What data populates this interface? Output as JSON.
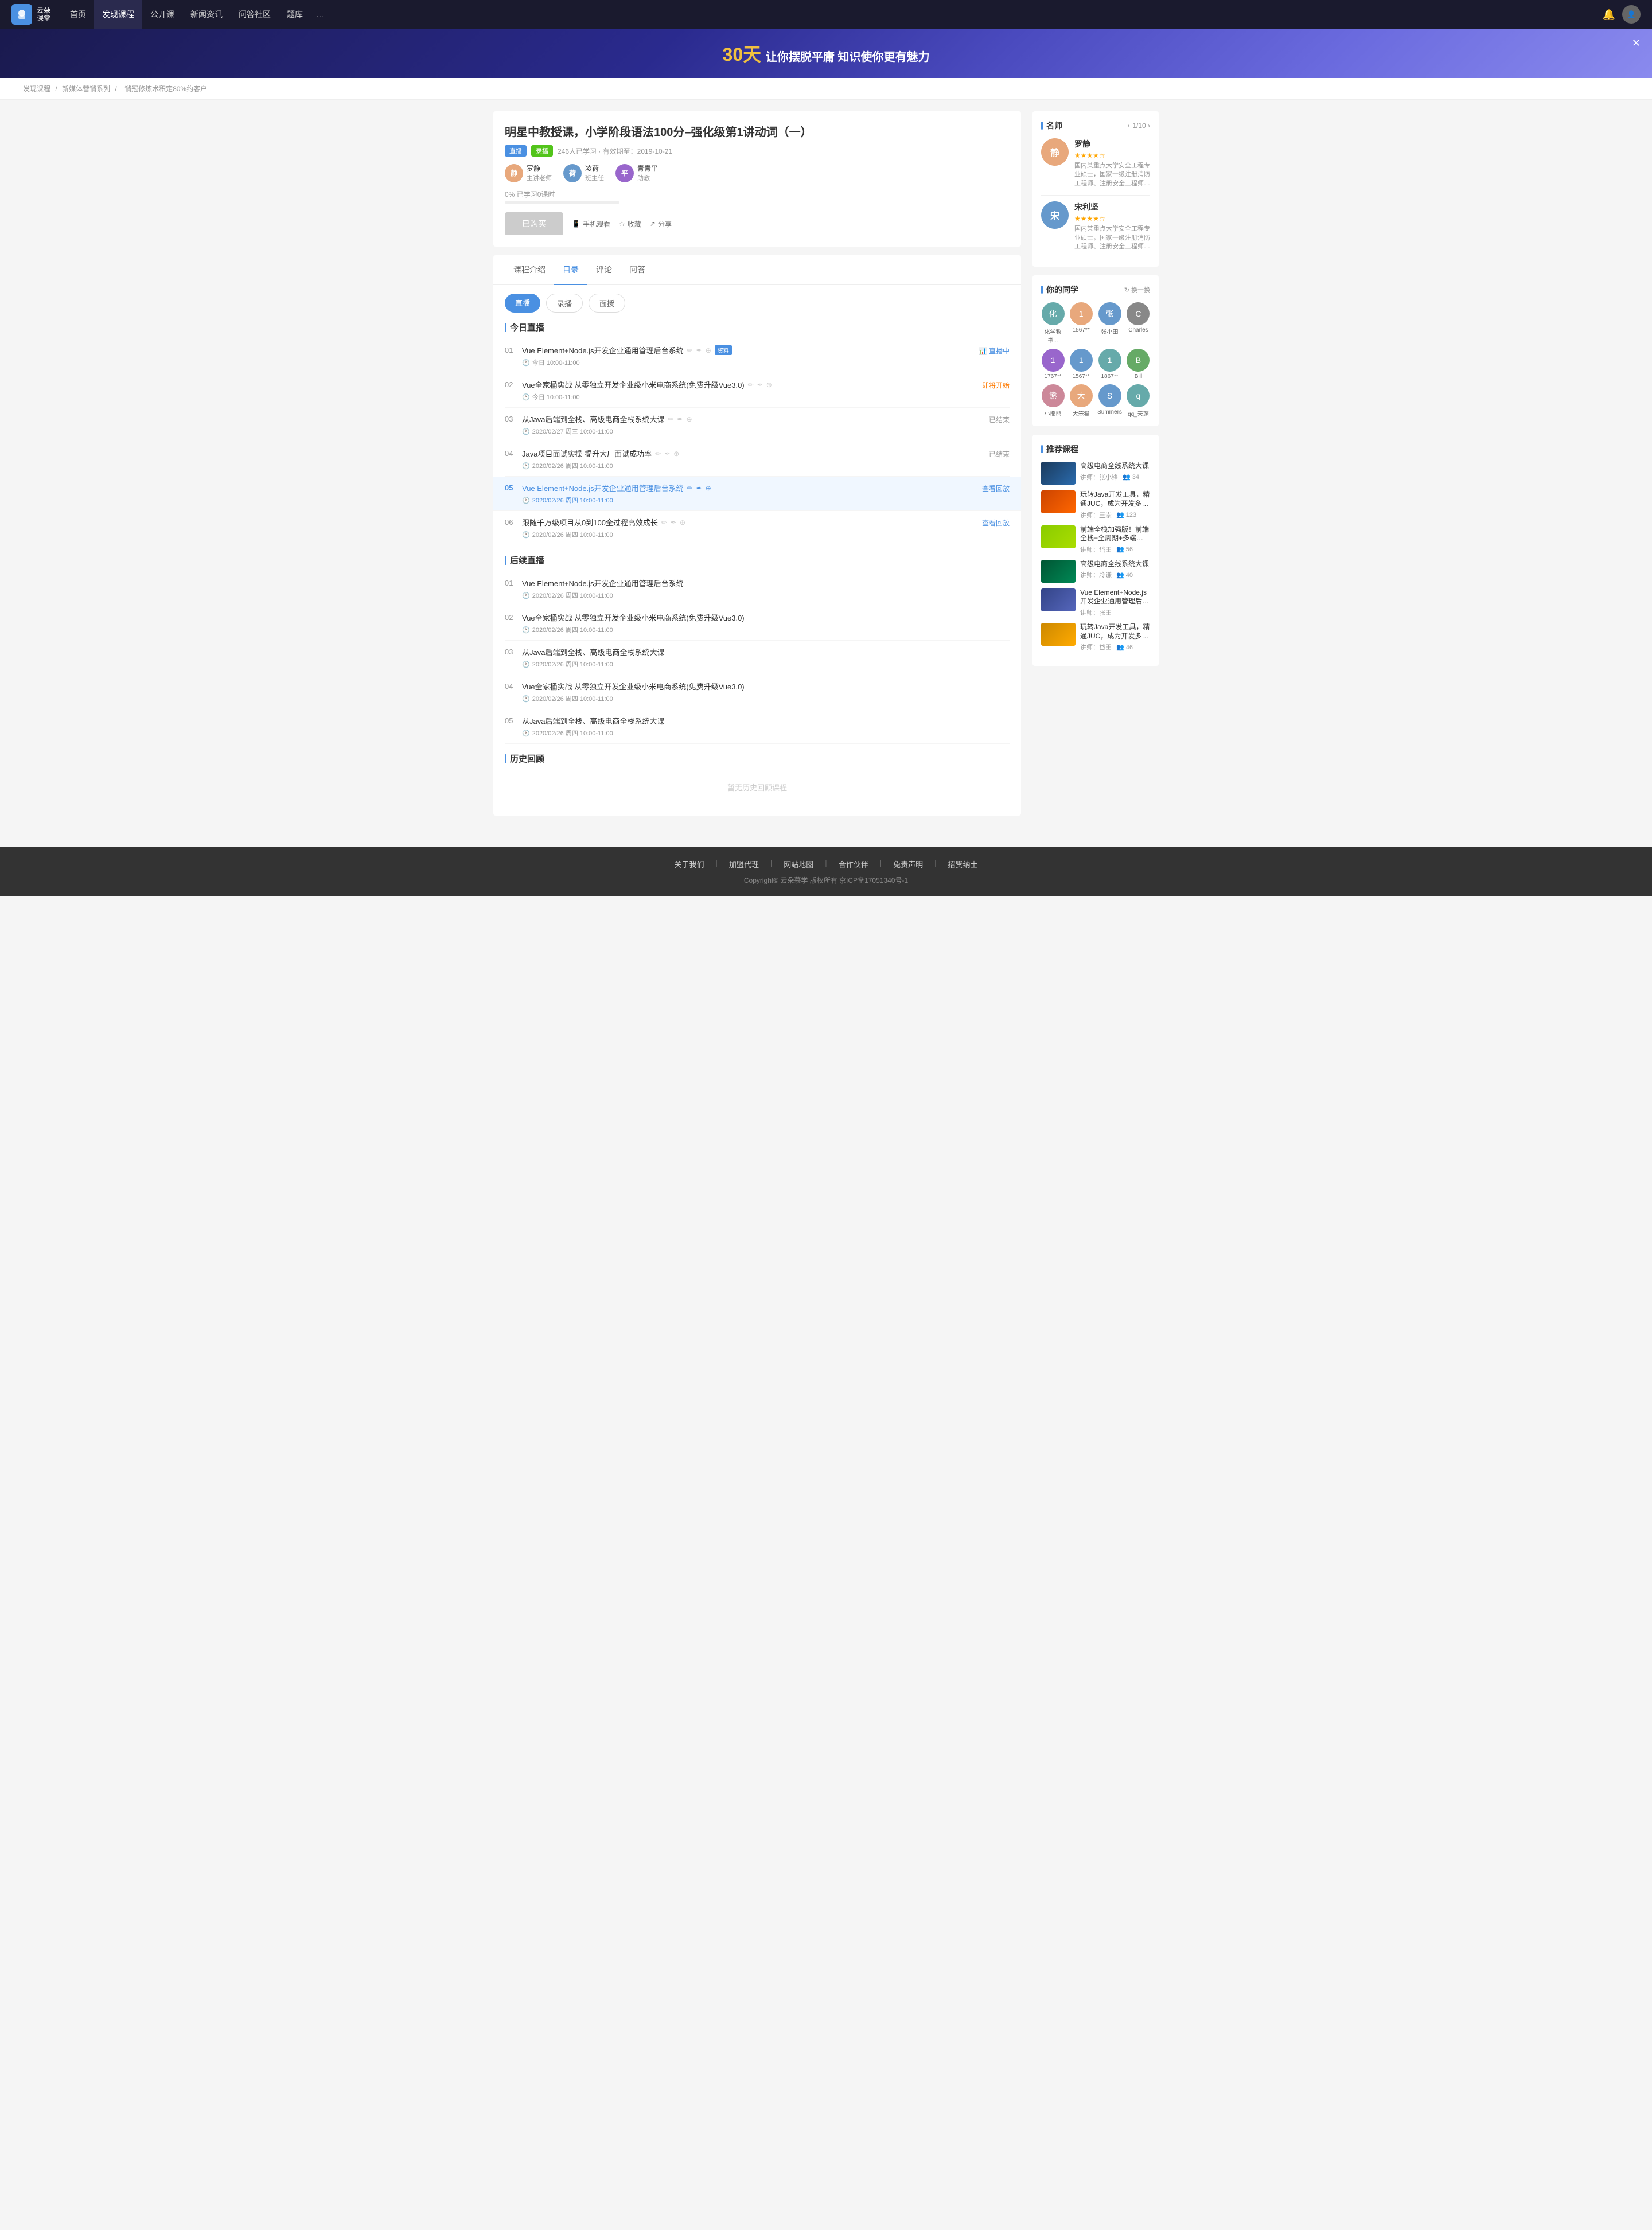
{
  "header": {
    "logo_text_line1": "云朵",
    "logo_text_line2": "课堂",
    "nav_items": [
      {
        "label": "首页",
        "active": false
      },
      {
        "label": "发现课程",
        "active": true
      },
      {
        "label": "公开课",
        "active": false
      },
      {
        "label": "新闻资讯",
        "active": false
      },
      {
        "label": "问答社区",
        "active": false
      },
      {
        "label": "题库",
        "active": false
      }
    ],
    "more": "..."
  },
  "banner": {
    "highlight": "30天",
    "text": "让你摆脱平庸  知识使你更有魅力"
  },
  "breadcrumb": {
    "items": [
      "发现课程",
      "新媒体营销系列",
      "销冠修炼术积定80%约客户"
    ]
  },
  "course": {
    "title": "明星中教授课，小学阶段语法100分–强化级第1讲动词（一）",
    "tags": [
      "直播",
      "录播"
    ],
    "meta": "246人已学习 · 有效期至：2019-10-21",
    "teachers": [
      {
        "name": "罗静",
        "role": "主讲老师"
      },
      {
        "name": "凌荷",
        "role": "班主任"
      },
      {
        "name": "青青平",
        "role": "助教"
      }
    ],
    "progress": "0%",
    "progress_label": "已学习0课时",
    "btn_purchased": "已购买",
    "btn_mobile": "手机观看",
    "btn_collect": "收藏",
    "btn_share": "分享"
  },
  "tabs": {
    "items": [
      "课程介绍",
      "目录",
      "评论",
      "问答"
    ],
    "active": "目录"
  },
  "sub_tabs": {
    "items": [
      "直播",
      "录播",
      "面授"
    ],
    "active": "直播"
  },
  "sections": {
    "today_live": {
      "title": "今日直播",
      "lessons": [
        {
          "num": "01",
          "title": "Vue Element+Node.js开发企业通用管理后台系统",
          "has_icons": true,
          "has_material": true,
          "time": "今日 10:00-11:00",
          "status": "直播中",
          "status_type": "live"
        },
        {
          "num": "02",
          "title": "Vue全家桶实战 从零独立开发企业级小米电商系统(免费升级Vue3.0)",
          "has_icons": true,
          "time": "今日 10:00-11:00",
          "status": "即将开始",
          "status_type": "starting"
        },
        {
          "num": "03",
          "title": "从Java后端到全栈、高级电商全栈系统大课",
          "has_icons": true,
          "time": "2020/02/27 周三 10:00-11:00",
          "status": "已结束",
          "status_type": "ended"
        },
        {
          "num": "04",
          "title": "Java项目面试实操 提升大厂面试成功率",
          "has_icons": true,
          "time": "2020/02/26 周四 10:00-11:00",
          "status": "已结束",
          "status_type": "ended"
        },
        {
          "num": "05",
          "title": "Vue Element+Node.js开发企业通用管理后台系统",
          "has_icons": true,
          "time": "2020/02/26 周四 10:00-11:00",
          "status": "查看回放",
          "status_type": "replay",
          "active": true
        },
        {
          "num": "06",
          "title": "跟随千万级项目从0到100全过程高效成长",
          "has_icons": true,
          "time": "2020/02/26 周四 10:00-11:00",
          "status": "查看回放",
          "status_type": "replay"
        }
      ]
    },
    "future_live": {
      "title": "后续直播",
      "lessons": [
        {
          "num": "01",
          "title": "Vue Element+Node.js开发企业通用管理后台系统",
          "time": "2020/02/26 周四 10:00-11:00"
        },
        {
          "num": "02",
          "title": "Vue全家桶实战 从零独立开发企业级小米电商系统(免费升级Vue3.0)",
          "time": "2020/02/26 周四 10:00-11:00"
        },
        {
          "num": "03",
          "title": "从Java后端到全栈、高级电商全栈系统大课",
          "time": "2020/02/26 周四 10:00-11:00"
        },
        {
          "num": "04",
          "title": "Vue全家桶实战 从零独立开发企业级小米电商系统(免费升级Vue3.0)",
          "time": "2020/02/26 周四 10:00-11:00"
        },
        {
          "num": "05",
          "title": "从Java后端到全栈、高级电商全栈系统大课",
          "time": "2020/02/26 周四 10:00-11:00"
        }
      ]
    },
    "history": {
      "title": "历史回顾",
      "empty_text": "暂无历史回顾课程"
    }
  },
  "sidebar": {
    "teachers_title": "名师",
    "teachers_nav": "1/10 ›",
    "teachers": [
      {
        "name": "罗静",
        "stars": 4,
        "desc": "国内某重点大学安全工程专业硕士，国家一级注册消防工程师、注册安全工程师、高级注册建造师，深海教育特家签..."
      },
      {
        "name": "宋利坚",
        "stars": 4,
        "desc": "国内某重点大学安全工程专业硕士，国家一级注册消防工程师、注册安全工程师、级注册建造师，独家签约讲师，累计授..."
      }
    ],
    "classmates_title": "你的同学",
    "refresh_label": "换一换",
    "classmates": [
      {
        "name": "化学教书...",
        "color": "av-teal"
      },
      {
        "name": "1567**",
        "color": "av-orange"
      },
      {
        "name": "张小田",
        "color": "av-blue"
      },
      {
        "name": "Charles",
        "color": "av-gray"
      },
      {
        "name": "1767**",
        "color": "av-purple"
      },
      {
        "name": "1567**",
        "color": "av-blue"
      },
      {
        "name": "1867**",
        "color": "av-teal"
      },
      {
        "name": "Bill",
        "color": "av-green"
      },
      {
        "name": "小熊熊",
        "color": "av-pink"
      },
      {
        "name": "大笨猫",
        "color": "av-orange"
      },
      {
        "name": "Summers",
        "color": "av-blue"
      },
      {
        "name": "qq_天蓬",
        "color": "av-teal"
      }
    ],
    "recommend_title": "推荐课程",
    "recommended": [
      {
        "title": "高级电商全线系统大课",
        "lecturer": "张小锋",
        "students": "34",
        "thumb_class": "rec-thumb-1"
      },
      {
        "title": "玩转Java开发工具，精通JUC，成为开发多面手",
        "lecturer": "王崇",
        "students": "123",
        "thumb_class": "rec-thumb-2"
      },
      {
        "title": "前端全栈加强版！前端全栈+全周期+多端应用",
        "lecturer": "岱田",
        "students": "56",
        "thumb_class": "rec-thumb-3"
      },
      {
        "title": "高级电商全线系统大课",
        "lecturer": "冷谦",
        "students": "40",
        "thumb_class": "rec-thumb-4"
      },
      {
        "title": "Vue Element+Node.js开发企业通用管理后台系统",
        "lecturer": "张田",
        "students": "",
        "thumb_class": "rec-thumb-5"
      },
      {
        "title": "玩转Java开发工具，精通JUC，成为开发多面手",
        "lecturer": "岱田",
        "students": "46",
        "thumb_class": "rec-thumb-6"
      }
    ]
  },
  "footer": {
    "links": [
      "关于我们",
      "加盟代理",
      "网站地图",
      "合作伙伴",
      "免责声明",
      "招贤纳士"
    ],
    "copyright": "Copyright© 云朵慕学  版权所有   京ICP备17051340号-1"
  }
}
